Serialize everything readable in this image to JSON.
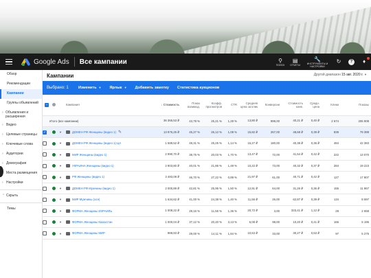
{
  "header": {
    "product": "Google Ads",
    "title": "Все кампании",
    "tools": [
      {
        "label": "ПОИСК",
        "icon": "search-icon"
      },
      {
        "label": "ОТЧЕТЫ",
        "icon": "reports-icon"
      },
      {
        "label": "ИНСТРУМЕНТЫ И НАСТРОЙКИ",
        "icon": "tools-icon"
      }
    ]
  },
  "sidebar": {
    "items": [
      {
        "label": "Обзор",
        "active": false
      },
      {
        "label": "Рекомендации",
        "active": false
      },
      {
        "label": "Кампании",
        "active": true
      },
      {
        "label": "Группы объявлений",
        "active": false
      },
      {
        "label": "Объявления и расширения",
        "active": false,
        "chev": true
      },
      {
        "label": "Видео",
        "active": false,
        "chev": true
      },
      {
        "label": "Целевые страницы",
        "active": false,
        "chev": true
      },
      {
        "label": "Ключевые слова",
        "active": false,
        "chev": true
      },
      {
        "label": "Аудитории",
        "active": false,
        "chev": true
      },
      {
        "label": "Демография",
        "active": false,
        "chev": true
      },
      {
        "label": "Места размещения",
        "active": false,
        "chev": true
      },
      {
        "label": "Настройки",
        "active": false,
        "chev": true
      }
    ],
    "hide": "Скрыть",
    "topics": "Темы"
  },
  "main": {
    "title": "Кампании",
    "date_label": "Другой диапазон",
    "date_value": "15 авг. 2020 г.",
    "selection": "Выбрано: 1",
    "actions": [
      {
        "label": "Изменить",
        "caret": true
      },
      {
        "label": "Ярлык",
        "caret": true
      },
      {
        "label": "Добавить заметку",
        "caret": false
      },
      {
        "label": "Статистика аукционов",
        "caret": false
      }
    ]
  },
  "table": {
    "columns": [
      "Кампания",
      "Стоимость",
      "Показ взаимод.",
      "Коэфф. просмотров",
      "CTR",
      "Средняя цена за клик",
      "Конверсии",
      "Стоимость конв.",
      "Средн. цена",
      "Клики",
      "Показы"
    ],
    "total": {
      "label": "Итого (все кампании)",
      "values": [
        "36 365,53 ₽",
        "43,79 %",
        "25,21 %",
        "1,29 %",
        "13,80 ₽",
        "999,00",
        "40,21 ₽",
        "0,40 ₽",
        "2 674",
        "206 908"
      ]
    },
    "rows": [
      {
        "name": "ДОМЕН РФ Женщины (видео 1)",
        "selected": true,
        "values": [
          "13 976,25 ₽",
          "45,27 %",
          "26,12 %",
          "1,08 %",
          "15,82 ₽",
          "267,00",
          "48,68 ₽",
          "0,39 ₽",
          "839",
          "79 399"
        ]
      },
      {
        "name": "ДОМЕН РФ Женщины (видео 1) ЦА",
        "selected": false,
        "values": [
          "1 589,52 ₽",
          "48,31 %",
          "25,25 %",
          "1,14 %",
          "15,27 ₽",
          "180,00",
          "40,38 ₽",
          "0,36 ₽",
          "484",
          "42 383"
        ]
      },
      {
        "name": "МИР Женщины (видео 1)",
        "selected": false,
        "values": [
          "2 990,70 ₽",
          "38,75 %",
          "20,03 %",
          "1,70 %",
          "13,47 ₽",
          "72,00",
          "41,54 ₽",
          "0,42 ₽",
          "222",
          "13 070"
        ]
      },
      {
        "name": "УКРАИНА Женщины (видео 1)",
        "selected": false,
        "values": [
          "2 903,80 ₽",
          "40,01 %",
          "21,86 %",
          "1,48 %",
          "10,22 ₽",
          "73,00",
          "40,32 ₽",
          "0,37 ₽",
          "284",
          "19 223"
        ]
      },
      {
        "name": "РФ Женщины (видео 1)",
        "selected": false,
        "values": [
          "3 483,08 ₽",
          "46,70 %",
          "27,22 %",
          "0,89 %",
          "21,97 ₽",
          "61,00",
          "40,71 ₽",
          "0,42 ₽",
          "127",
          "17 807"
        ]
      },
      {
        "name": "ДОМЕН РФ Мужчины (видео 1)",
        "selected": false,
        "values": [
          "2 000,89 ₽",
          "42,81 %",
          "25,95 %",
          "1,50 %",
          "12,91 ₽",
          "64,00",
          "31,26 ₽",
          "0,36 ₽",
          "155",
          "11 967"
        ]
      },
      {
        "name": "МИР Мужчины (осн)",
        "selected": false,
        "values": [
          "1 634,62 ₽",
          "41,00 %",
          "24,38 %",
          "1,40 %",
          "11,56 ₽",
          "26,00",
          "62,87 ₽",
          "0,39 ₽",
          "134",
          "8 697"
        ]
      },
      {
        "name": "ФОРМА Женщины ИЗРАИЛЬ",
        "selected": false,
        "values": [
          "1 008,22 ₽",
          "28,16 %",
          "11,55 %",
          "1,36 %",
          "20,72 ₽",
          "3,00",
          "333,41 ₽",
          "1,12 ₽",
          "28",
          "2 658"
        ]
      },
      {
        "name": "ФОРМА Женщины Казахстан",
        "selected": false,
        "values": [
          "1 000,04 ₽",
          "37,12 %",
          "20,40 %",
          "3,13 %",
          "6,08 ₽",
          "98,00",
          "10,20 ₽",
          "0,41 ₽",
          "166",
          "5 196"
        ]
      },
      {
        "name": "ФОРМА Женщины МИР",
        "selected": false,
        "values": [
          "998,83 ₽",
          "29,00 %",
          "14,11 %",
          "1,84 %",
          "10,63 ₽",
          "33,00",
          "30,27 ₽",
          "0,53 ₽",
          "97",
          "5 275"
        ]
      }
    ]
  }
}
